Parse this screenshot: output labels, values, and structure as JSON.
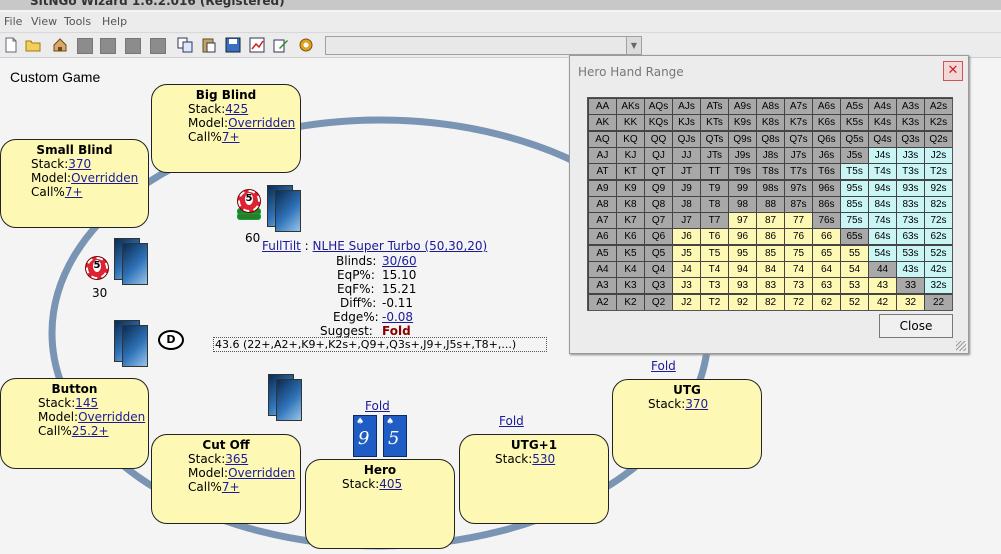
{
  "app_title": "SitNGo Wizard 1.6.2.016 (Registered)",
  "menu": [
    "File",
    "View",
    "Tools",
    "Help"
  ],
  "game_title": "Custom Game",
  "labels": {
    "stack": "Stack:",
    "model": "Model:",
    "callpct": "Call%"
  },
  "seats": {
    "big_blind": {
      "name": "Big Blind",
      "stack": "425",
      "model": "Overridden",
      "call": "7+"
    },
    "small_blind": {
      "name": "Small Blind",
      "stack": "370",
      "model": "Overridden",
      "call": "7+"
    },
    "button": {
      "name": "Button",
      "stack": "145",
      "model": "Overridden",
      "call": "25.2+"
    },
    "cut_off": {
      "name": "Cut Off",
      "stack": "365",
      "model": "Overridden",
      "call": "7+"
    },
    "hero": {
      "name": "Hero",
      "stack": "405"
    },
    "utg1": {
      "name": "UTG+1",
      "stack": "530"
    },
    "utg": {
      "name": "UTG",
      "stack": "370"
    }
  },
  "bets": {
    "bb_bet": "60",
    "sb_bet": "30"
  },
  "dealer_label": "D",
  "folds": {
    "hero": "Fold",
    "utg1": "Fold",
    "utg": "Fold"
  },
  "hero_cards": [
    {
      "rank": "9",
      "suit": "♠"
    },
    {
      "rank": "5",
      "suit": "♠"
    }
  ],
  "info": {
    "site": "FullTilt",
    "sep": " : ",
    "structure": "NLHE Super Turbo (50,30,20)",
    "blinds_label": "Blinds:",
    "blinds": "30/60",
    "eqp_label": "EqP%:",
    "eqp": "15.10",
    "eqf_label": "EqF%:",
    "eqf": "15.21",
    "diff_label": "Diff%:",
    "diff": "-0.11",
    "edge_label": "Edge%:",
    "edge": "-0.08",
    "suggest_label": "Suggest:",
    "suggest": "Fold",
    "range": "43.6 (22+,A2+,K9+,K2s+,Q9+,Q3s+,J9+,J5s+,T8+,...)"
  },
  "range_window": {
    "title": "Hero Hand Range",
    "close_label": "Close",
    "close_x": "✕",
    "rows": [
      [
        "AA",
        "AKs",
        "AQs",
        "AJs",
        "ATs",
        "A9s",
        "A8s",
        "A7s",
        "A6s",
        "A5s",
        "A4s",
        "A3s",
        "A2s"
      ],
      [
        "AK",
        "KK",
        "KQs",
        "KJs",
        "KTs",
        "K9s",
        "K8s",
        "K7s",
        "K6s",
        "K5s",
        "K4s",
        "K3s",
        "K2s"
      ],
      [
        "AQ",
        "KQ",
        "QQ",
        "QJs",
        "QTs",
        "Q9s",
        "Q8s",
        "Q7s",
        "Q6s",
        "Q5s",
        "Q4s",
        "Q3s",
        "Q2s"
      ],
      [
        "AJ",
        "KJ",
        "QJ",
        "JJ",
        "JTs",
        "J9s",
        "J8s",
        "J7s",
        "J6s",
        "J5s",
        "J4s",
        "J3s",
        "J2s"
      ],
      [
        "AT",
        "KT",
        "QT",
        "JT",
        "TT",
        "T9s",
        "T8s",
        "T7s",
        "T6s",
        "T5s",
        "T4s",
        "T3s",
        "T2s"
      ],
      [
        "A9",
        "K9",
        "Q9",
        "J9",
        "T9",
        "99",
        "98s",
        "97s",
        "96s",
        "95s",
        "94s",
        "93s",
        "92s"
      ],
      [
        "A8",
        "K8",
        "Q8",
        "J8",
        "T8",
        "98",
        "88",
        "87s",
        "86s",
        "85s",
        "84s",
        "83s",
        "82s"
      ],
      [
        "A7",
        "K7",
        "Q7",
        "J7",
        "T7",
        "97",
        "87",
        "77",
        "76s",
        "75s",
        "74s",
        "73s",
        "72s"
      ],
      [
        "A6",
        "K6",
        "Q6",
        "J6",
        "T6",
        "96",
        "86",
        "76",
        "66",
        "65s",
        "64s",
        "63s",
        "62s"
      ],
      [
        "A5",
        "K5",
        "Q5",
        "J5",
        "T5",
        "95",
        "85",
        "75",
        "65",
        "55",
        "54s",
        "53s",
        "52s"
      ],
      [
        "A4",
        "K4",
        "Q4",
        "J4",
        "T4",
        "94",
        "84",
        "74",
        "64",
        "54",
        "44",
        "43s",
        "42s"
      ],
      [
        "A3",
        "K3",
        "Q3",
        "J3",
        "T3",
        "93",
        "83",
        "73",
        "63",
        "53",
        "43",
        "33",
        "32s"
      ],
      [
        "A2",
        "K2",
        "Q2",
        "J2",
        "T2",
        "92",
        "82",
        "72",
        "62",
        "52",
        "42",
        "32",
        "22"
      ]
    ],
    "colors": [
      "ggggggggggggg",
      "ggggggggggggg",
      "gggggggggggggc",
      "ggggggggggccc",
      "gggggggggcccc",
      "gggggggggcccc",
      "gggggggggcccc",
      "gggggyyygcccc",
      "gggyyyyyygccc",
      "gggyyyyyyyccc",
      "gggyyyyyyygcc",
      "gggyyyyyyyygc",
      "gggyyyyyyyyyg"
    ],
    "color_map": {
      "g": "#a8a8a8",
      "y": "#fdf8b4",
      "c": "#c9f5f5"
    }
  }
}
